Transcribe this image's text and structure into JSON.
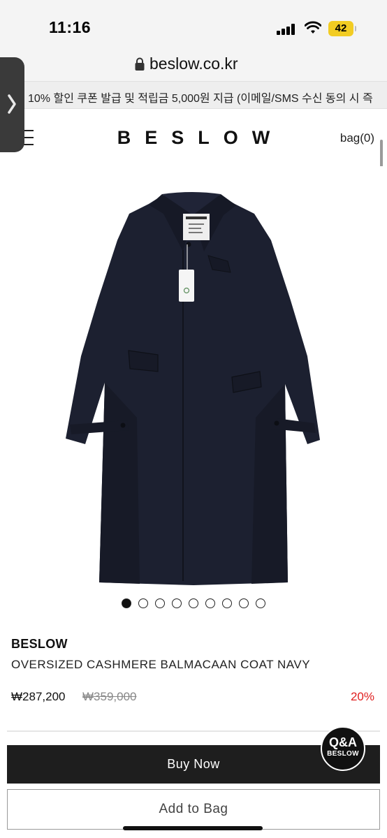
{
  "status_bar": {
    "time": "11:16",
    "battery": "42",
    "icons": [
      "signal-icon",
      "wifi-icon",
      "battery-icon"
    ]
  },
  "browser": {
    "url": "beslow.co.kr"
  },
  "promo": {
    "text": "10% 할인 쿠폰 발급 및 적립금 5,000원 지급 (이메일/SMS 수신 동의 시 즉"
  },
  "header": {
    "logo": "BESLOW",
    "bag_label": "bag(0)"
  },
  "product": {
    "brand": "BESLOW",
    "name": "OVERSIZED CASHMERE BALMACAAN COAT NAVY",
    "price": "₩287,200",
    "original_price": "₩359,000",
    "discount": "20%",
    "image_count": 9,
    "active_image": 1,
    "colors": {
      "coat": "#1c2030",
      "discount": "#e02020"
    }
  },
  "actions": {
    "buy_now": "Buy Now",
    "add_to_bag": "Add to Bag"
  },
  "qa": {
    "title": "Q&A",
    "subtitle": "BESLOW"
  }
}
